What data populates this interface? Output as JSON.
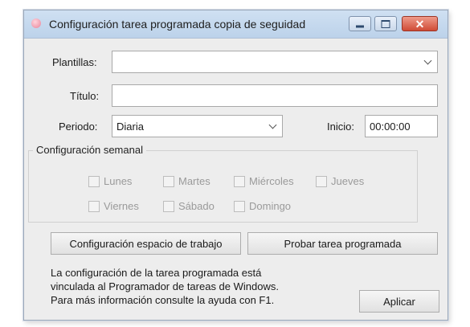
{
  "window": {
    "title": "Configuración tarea programada copia de seguidad",
    "close_glyph": "✕"
  },
  "form": {
    "plantillas_label": "Plantillas:",
    "plantillas_value": "",
    "titulo_label": "Título:",
    "titulo_value": "",
    "periodo_label": "Periodo:",
    "periodo_value": "Diaria",
    "inicio_label": "Inicio:",
    "inicio_value": "00:00:00"
  },
  "weekly": {
    "title": "Configuración semanal",
    "days": [
      "Lunes",
      "Martes",
      "Miércoles",
      "Jueves",
      "Viernes",
      "Sábado",
      "Domingo"
    ]
  },
  "buttons": {
    "workspace": "Configuración espacio de trabajo",
    "test": "Probar tarea programada",
    "apply": "Aplicar"
  },
  "info": {
    "line1": "La configuración de la tarea programada está",
    "line2": "vinculada al Programador de tareas de Windows.",
    "line3": "Para más información consulte la ayuda con F1."
  }
}
